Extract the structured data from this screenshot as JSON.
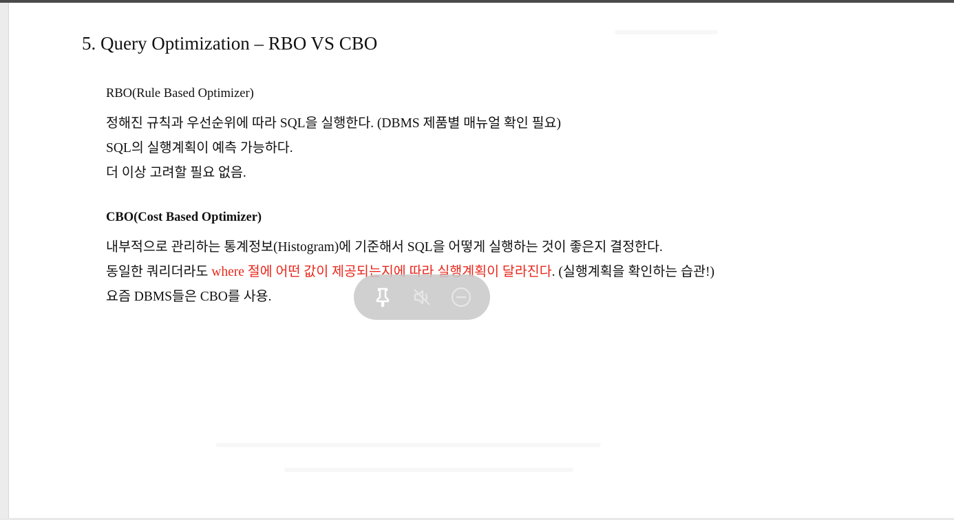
{
  "slide": {
    "title": "5. Query Optimization – RBO VS CBO",
    "rbo": {
      "heading": "RBO(Rule Based Optimizer)",
      "lines": [
        "정해진 규칙과 우선순위에 따라 SQL을 실행한다. (DBMS 제품별 매뉴얼 확인 필요)",
        "SQL의 실행계획이 예측 가능하다.",
        "더 이상 고려할 필요 없음."
      ]
    },
    "cbo": {
      "heading": "CBO(Cost Based Optimizer)",
      "line1": "내부적으로 관리하는 통계정보(Histogram)에 기준해서 SQL을 어떻게 실행하는 것이 좋은지 결정한다.",
      "line2_prefix": "동일한 쿼리더라도 ",
      "line2_highlight": "where 절에 어떤 값이 제공되는지에 따라 실행계획이 달라진다",
      "line2_suffix": ". (실행계획을 확인하는 습관!)",
      "line3": "요즘 DBMS들은 CBO를 사용."
    }
  },
  "overlay_controls": {
    "icons": [
      "pin-icon",
      "mute-icon",
      "minus-circle-icon"
    ]
  },
  "colors": {
    "highlight": "#e8281c",
    "text": "#111111",
    "overlay": "#c8c8c8"
  }
}
